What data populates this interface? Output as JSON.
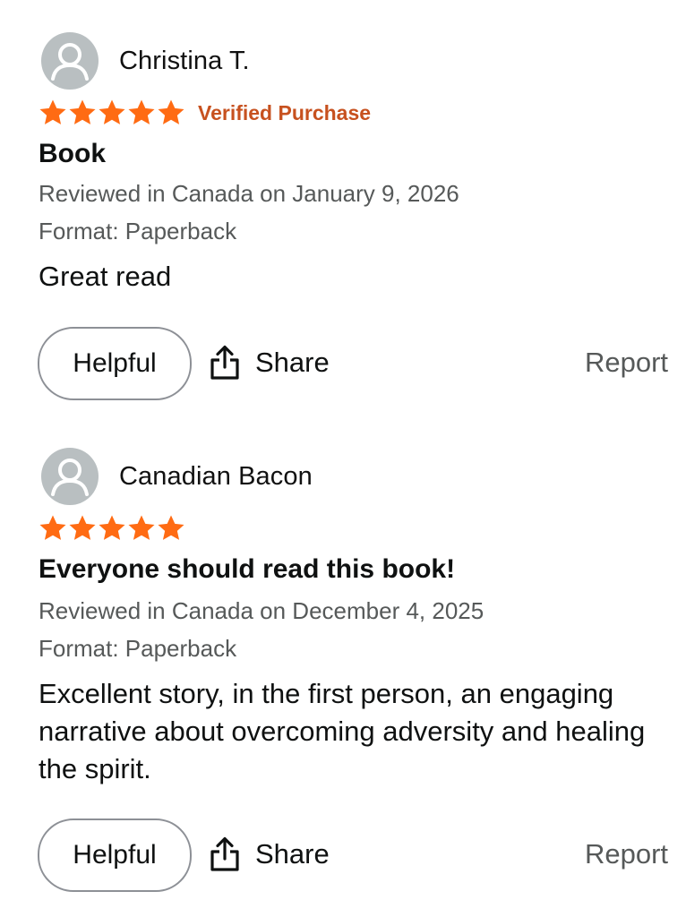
{
  "reviews": [
    {
      "reviewer_name": "Christina T.",
      "avatar_icon": "user-silhouette-icon",
      "stars": 5,
      "verified_label": "Verified Purchase",
      "title": "Book",
      "date": "Reviewed in Canada on January 9, 2026",
      "format": "Format: Paperback",
      "body": "Great read",
      "helpful_label": "Helpful",
      "share_label": "Share",
      "report_label": "Report"
    },
    {
      "reviewer_name": "Canadian Bacon",
      "avatar_icon": "user-silhouette-icon",
      "stars": 5,
      "verified_label": "",
      "title": "Everyone should read this book!",
      "date": "Reviewed in Canada on December 4, 2025",
      "format": "Format: Paperback",
      "body": "Excellent story, in the first person, an engaging narrative about overcoming adversity and healing the spirit.",
      "helpful_label": "Helpful",
      "share_label": "Share",
      "report_label": "Report"
    }
  ],
  "colors": {
    "star": "#ff6b13",
    "verified": "#c7511f",
    "meta": "#565959",
    "avatar_bg": "#b9bfc1"
  }
}
